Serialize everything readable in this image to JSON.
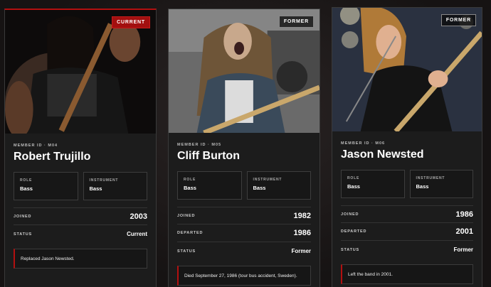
{
  "members": [
    {
      "status_badge": "CURRENT",
      "member_id": "MEMBER ID · M04",
      "name": "Robert Trujillo",
      "role_label": "ROLE",
      "role": "Bass",
      "instrument_label": "INSTRUMENT",
      "instrument": "Bass",
      "joined_label": "JOINED",
      "joined": "2003",
      "status_label": "STATUS",
      "status": "Current",
      "note": "Replaced Jason Newsted."
    },
    {
      "status_badge": "FORMER",
      "member_id": "MEMBER ID · M05",
      "name": "Cliff Burton",
      "role_label": "ROLE",
      "role": "Bass",
      "instrument_label": "INSTRUMENT",
      "instrument": "Bass",
      "joined_label": "JOINED",
      "joined": "1982",
      "departed_label": "DEPARTED",
      "departed": "1986",
      "status_label": "STATUS",
      "status": "Former",
      "note": "Died September 27, 1986 (tour bus accident, Sweden)."
    },
    {
      "status_badge": "FORMER",
      "member_id": "MEMBER ID · M06",
      "name": "Jason Newsted",
      "role_label": "ROLE",
      "role": "Bass",
      "instrument_label": "INSTRUMENT",
      "instrument": "Bass",
      "joined_label": "JOINED",
      "joined": "1986",
      "departed_label": "DEPARTED",
      "departed": "2001",
      "status_label": "STATUS",
      "status": "Former",
      "note": "Left the band in 2001."
    }
  ],
  "colors": {
    "accent": "#b31010",
    "card_bg": "#1c1c1c",
    "border": "#3a3a3a"
  }
}
